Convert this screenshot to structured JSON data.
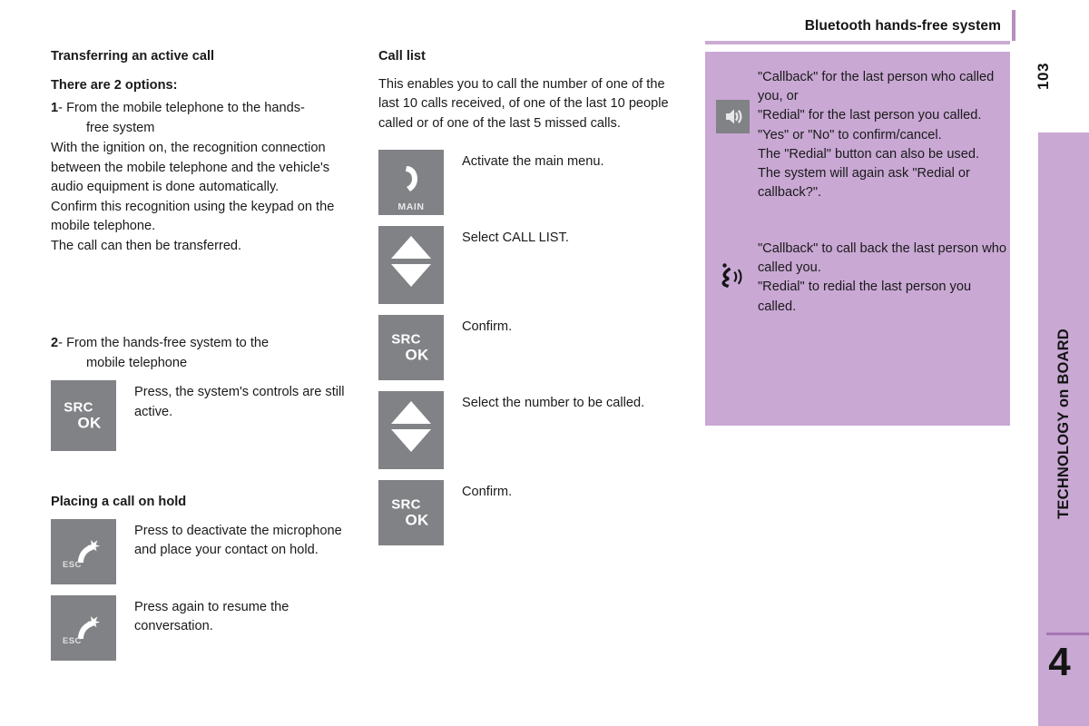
{
  "header": {
    "title": "Bluetooth hands-free system",
    "accent_color": "#c9a8d4"
  },
  "sidebar": {
    "page_number": "103",
    "section_label": "TECHNOLOGY on BOARD",
    "chapter_number": "4"
  },
  "left_column": {
    "heading": "Transferring an active call",
    "subheading": "There are 2 options:",
    "option1": {
      "number": "1",
      "dash": "-",
      "text_line1": "From the mobile telephone to the hands-",
      "text_line2": "free system"
    },
    "paragraph1": "With the ignition on, the recognition connection between the mobile telephone and the vehicle's audio equipment is done automatically.",
    "paragraph2": "Confirm this recognition using the keypad on the mobile telephone.",
    "paragraph3": "The call can then be transferred.",
    "option2": {
      "number": "2",
      "dash": "-",
      "text_line1": "From the hands-free system to the",
      "text_line2": "mobile telephone"
    },
    "step_srcok": {
      "button_src": "SRC",
      "button_ok": "OK",
      "caption": "Press, the system's controls are still active."
    },
    "hold_heading": "Placing a call on hold",
    "hold_step1": {
      "button_label": "ESC",
      "caption": "Press to deactivate the microphone and place your contact on hold."
    },
    "hold_step2": {
      "button_label": "ESC",
      "caption": "Press again to resume the conversation."
    }
  },
  "middle_column": {
    "heading": "Call list",
    "paragraph": "This enables you to call the number of one of the last 10 calls received, of one of the last 10 people called or of one of the last 5 missed calls.",
    "steps": [
      {
        "button_label": "MAIN",
        "caption": "Activate the main menu."
      },
      {
        "button_label": "",
        "caption": "Select CALL LIST."
      },
      {
        "button_src": "SRC",
        "button_ok": "OK",
        "caption": "Confirm."
      },
      {
        "button_label": "",
        "caption": "Select the number to be called."
      },
      {
        "button_src": "SRC",
        "button_ok": "OK",
        "caption": "Confirm."
      }
    ]
  },
  "panel": {
    "background_color": "#c9a8d4",
    "block1": {
      "icon": "speaker-icon",
      "text": "\"Callback\" for the last person who called you, or\n\"Redial\" for the last person you called.\n\"Yes\" or \"No\" to confirm/cancel.\nThe \"Redial\" button can also be used.\nThe system will again ask \"Redial or callback?\"."
    },
    "block2": {
      "icon": "voice-command-icon",
      "text": "\"Callback\" to call back the last person who called you.\n\"Redial\" to redial the last person you called."
    }
  }
}
